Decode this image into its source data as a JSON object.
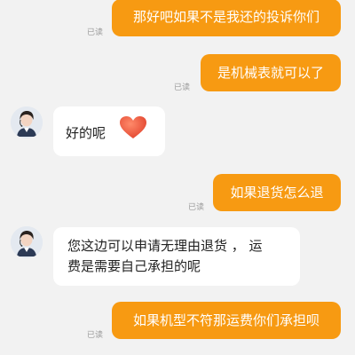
{
  "read_label": "已读",
  "messages": [
    {
      "side": "out",
      "text": "那好吧如果不是我还的投诉你们",
      "read": true
    },
    {
      "side": "out",
      "text": "是机械表就可以了",
      "read": true
    },
    {
      "side": "in",
      "text": "好的呢",
      "emoji": "heart-icon"
    },
    {
      "side": "out",
      "text": "如果退货怎么退",
      "read": true
    },
    {
      "side": "in",
      "lines": [
        "您这边可以申请无理由退货 ， 运",
        "费是需要自己承担的呢"
      ]
    },
    {
      "side": "out",
      "text": "如果机型不符那运费你们承担呗",
      "read": true
    }
  ],
  "colors": {
    "accent": "#f79a12",
    "background": "#f2f2f2",
    "incoming_bubble": "#ffffff",
    "read_text": "#9a9a9a"
  }
}
